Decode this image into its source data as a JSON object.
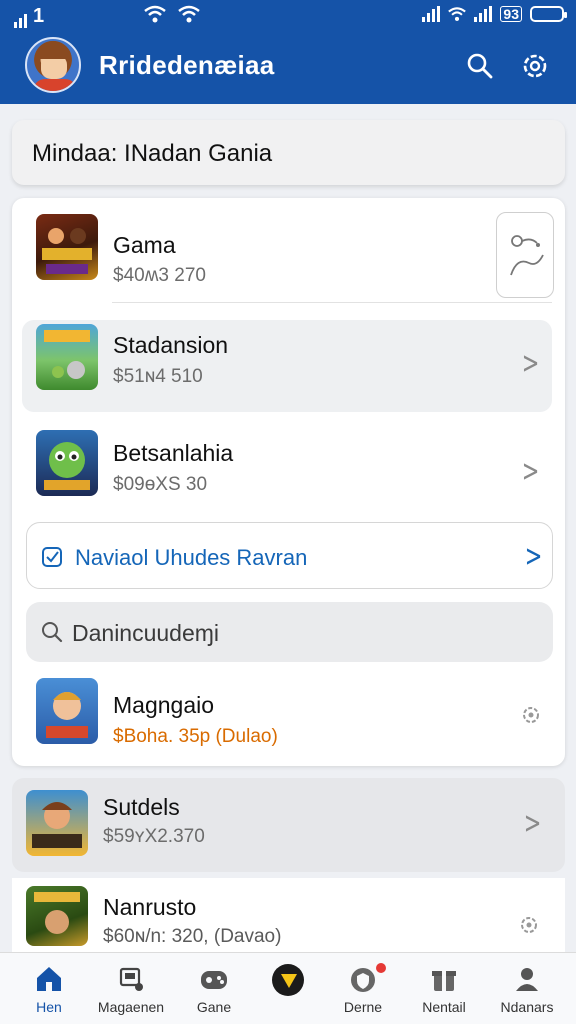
{
  "status": {
    "time": "1",
    "battery_label": "93"
  },
  "appbar": {
    "title": "Rridedenæiaa"
  },
  "destination": {
    "label": "Mindaa: INadan Gania"
  },
  "items": [
    {
      "title": "Gama",
      "price": "$40ʍ3 270"
    },
    {
      "title": "Stadansion",
      "price": "$51ɴ4 510"
    },
    {
      "title": "Betsanlahia",
      "price": "$09ɵXS 30"
    }
  ],
  "notice": {
    "label": "Naviaol Uhudes Ravran"
  },
  "search": {
    "placeholder": "Danincuudeɱi"
  },
  "featured": {
    "title": "Magngaio",
    "price": "$Boha. 35p (Dulao)"
  },
  "lower_items": [
    {
      "title": "Sutdels",
      "price": "$59ʏX2.370"
    },
    {
      "title": "Nanrusto",
      "price": "$60ɴ/n: 320, (Davao)"
    }
  ],
  "tabs": [
    {
      "label": "Hen",
      "icon": "home-icon"
    },
    {
      "label": "Magaenen",
      "icon": "cart-icon"
    },
    {
      "label": "Gane",
      "icon": "gamepad-icon"
    },
    {
      "label": "",
      "icon": "play-icon"
    },
    {
      "label": "Derne",
      "icon": "shield-icon"
    },
    {
      "label": "Nentail",
      "icon": "gift-icon"
    },
    {
      "label": "Ndanars",
      "icon": "profile-icon"
    }
  ],
  "colors": {
    "primary": "#1553a8",
    "accent_orange": "#d96b00",
    "link_blue": "#1566b8"
  }
}
